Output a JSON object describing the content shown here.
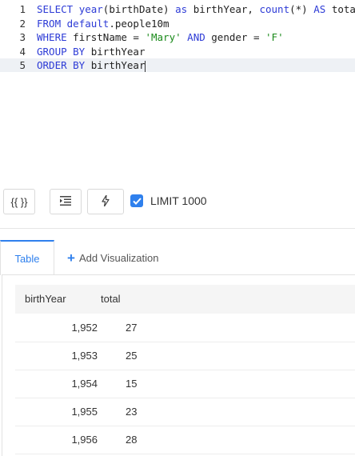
{
  "editor": {
    "lines": [
      {
        "num": "1",
        "tokens": [
          {
            "t": "SELECT",
            "c": "kw"
          },
          {
            "t": " ",
            "c": "plain"
          },
          {
            "t": "year",
            "c": "fn"
          },
          {
            "t": "(birthDate) ",
            "c": "plain"
          },
          {
            "t": "as",
            "c": "kw"
          },
          {
            "t": " birthYear, ",
            "c": "plain"
          },
          {
            "t": "count",
            "c": "fn"
          },
          {
            "t": "(*) ",
            "c": "plain"
          },
          {
            "t": "AS",
            "c": "kw"
          },
          {
            "t": " total",
            "c": "plain"
          }
        ]
      },
      {
        "num": "2",
        "tokens": [
          {
            "t": "FROM",
            "c": "kw"
          },
          {
            "t": " ",
            "c": "plain"
          },
          {
            "t": "default",
            "c": "kw"
          },
          {
            "t": ".people10m",
            "c": "plain"
          }
        ]
      },
      {
        "num": "3",
        "tokens": [
          {
            "t": "WHERE",
            "c": "kw"
          },
          {
            "t": " firstName = ",
            "c": "plain"
          },
          {
            "t": "'Mary'",
            "c": "str"
          },
          {
            "t": " ",
            "c": "plain"
          },
          {
            "t": "AND",
            "c": "kw"
          },
          {
            "t": " gender = ",
            "c": "plain"
          },
          {
            "t": "'F'",
            "c": "str"
          }
        ]
      },
      {
        "num": "4",
        "tokens": [
          {
            "t": "GROUP BY",
            "c": "kw"
          },
          {
            "t": " birthYear",
            "c": "plain"
          }
        ]
      },
      {
        "num": "5",
        "tokens": [
          {
            "t": "ORDER BY",
            "c": "kw"
          },
          {
            "t": " birthYear",
            "c": "plain"
          }
        ]
      }
    ]
  },
  "toolbar": {
    "params_label": "{{ }}",
    "format_icon": "indent-icon",
    "autocomplete_icon": "lightning-icon",
    "limit_label": "LIMIT 1000",
    "limit_checked": true
  },
  "tabs": {
    "table_label": "Table",
    "add_viz_label": "Add Visualization"
  },
  "table": {
    "columns": [
      "birthYear",
      "total"
    ],
    "rows": [
      [
        "1,952",
        "27"
      ],
      [
        "1,953",
        "25"
      ],
      [
        "1,954",
        "15"
      ],
      [
        "1,955",
        "23"
      ],
      [
        "1,956",
        "28"
      ]
    ]
  },
  "colors": {
    "accent": "#2f80ed",
    "keyword": "#2d3bd6",
    "string": "#1a8a1a"
  }
}
